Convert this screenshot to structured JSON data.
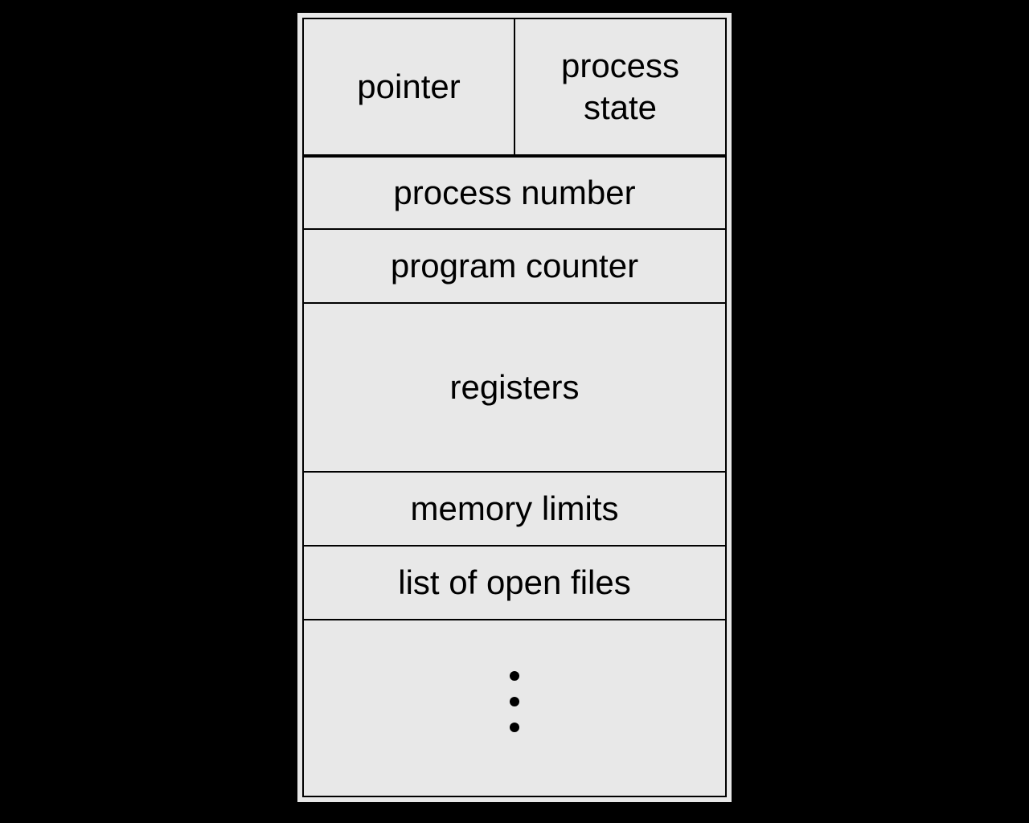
{
  "pcb": {
    "pointer": "pointer",
    "process_state": "process state",
    "process_number": "process number",
    "program_counter": "program counter",
    "registers": "registers",
    "memory_limits": "memory limits",
    "list_of_open_files": "list of open files"
  }
}
